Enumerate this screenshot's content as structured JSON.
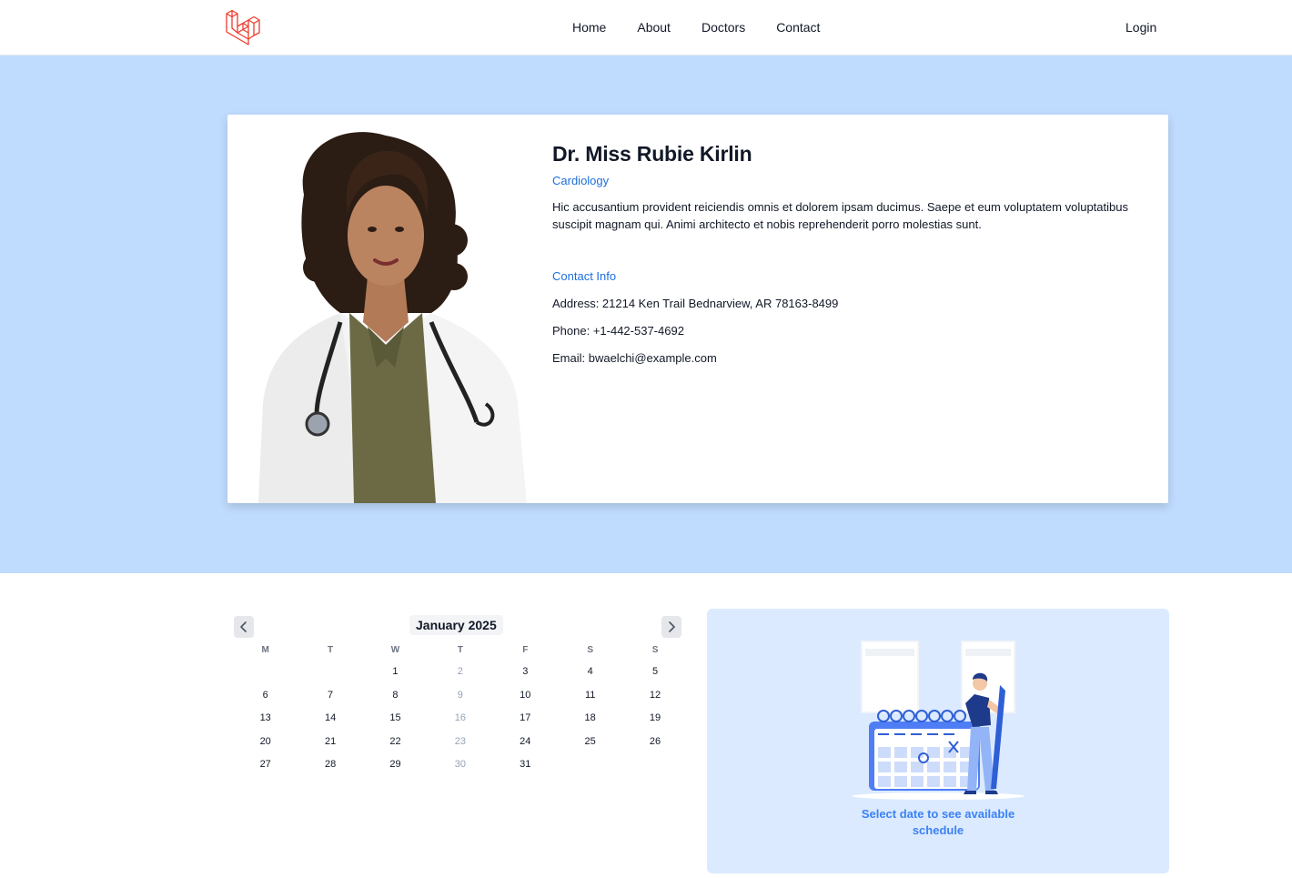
{
  "nav": {
    "links": [
      "Home",
      "About",
      "Doctors",
      "Contact"
    ],
    "login": "Login"
  },
  "doctor": {
    "name": "Dr. Miss Rubie Kirlin",
    "specialty": "Cardiology",
    "bio": "Hic accusantium provident reiciendis omnis et dolorem ipsam ducimus. Saepe et eum voluptatem voluptatibus suscipit magnam qui. Animi architecto et nobis reprehenderit porro molestias sunt.",
    "contact_title": "Contact Info",
    "address": "Address: 21214 Ken Trail Bednarview, AR 78163-8499",
    "phone": "Phone: +1-442-537-4692",
    "email": "Email: bwaelchi@example.com"
  },
  "calendar": {
    "month_label": "January 2025",
    "weekdays": [
      "M",
      "T",
      "W",
      "T",
      "F",
      "S",
      "S"
    ],
    "leading_blanks": 2,
    "days": [
      1,
      2,
      3,
      4,
      5,
      6,
      7,
      8,
      9,
      10,
      11,
      12,
      13,
      14,
      15,
      16,
      17,
      18,
      19,
      20,
      21,
      22,
      23,
      24,
      25,
      26,
      27,
      28,
      29,
      30,
      31
    ],
    "disabled_days": [
      2,
      9,
      16,
      23,
      30
    ]
  },
  "schedule": {
    "message": "Select date to see available schedule"
  },
  "colors": {
    "accent": "#1d6fdc",
    "hero_bg": "#bfdbfe",
    "panel_bg": "#dbeafe",
    "logo": "#ef3b2d"
  }
}
